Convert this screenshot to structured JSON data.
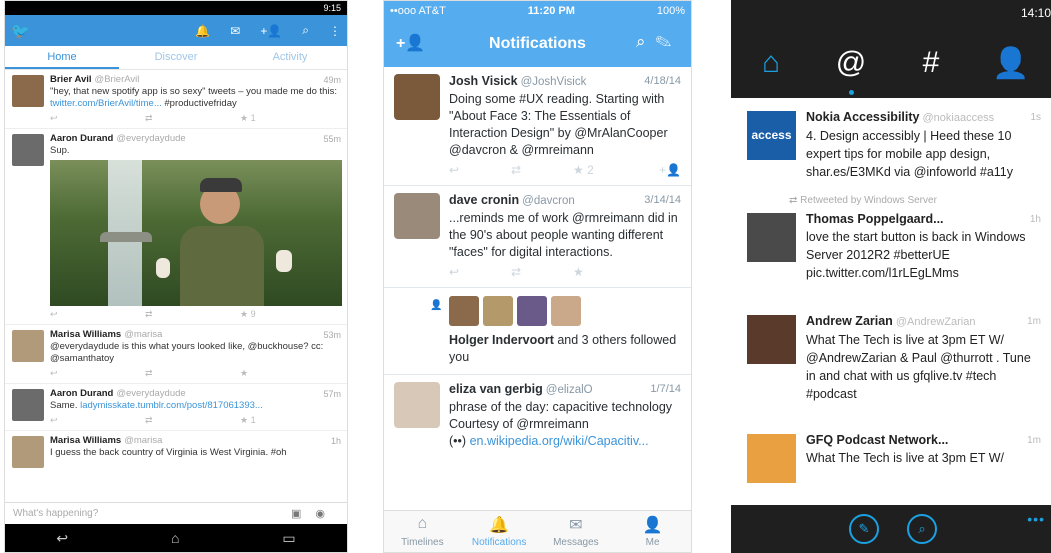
{
  "android": {
    "status_time": "9:15",
    "tabs": [
      "Home",
      "Discover",
      "Activity"
    ],
    "tweets": [
      {
        "name": "Brier Avil",
        "handle": "@BrierAvil",
        "time": "49m",
        "text": "\"hey, that new spotify app is so sexy\" tweets – you made me do this: ",
        "link": "twitter.com/BrierAvil/time...",
        "tail": " #productivefriday",
        "stars": "1"
      },
      {
        "name": "Aaron Durand",
        "handle": "@everydaydude",
        "time": "55m",
        "text": "Sup.",
        "stars": "9"
      },
      {
        "name": "Marisa Williams",
        "handle": "@marisa",
        "time": "53m",
        "text": "@everydaydude is this what yours looked like, @buckhouse? cc: @samanthatoy"
      },
      {
        "name": "Aaron Durand",
        "handle": "@everydaydude",
        "time": "57m",
        "text": "Same. ",
        "link": "ladymisskate.tumblr.com/post/817061393...",
        "stars": "1"
      },
      {
        "name": "Marisa Williams",
        "handle": "@marisa",
        "time": "1h",
        "text": "I guess the back country of Virginia is West Virginia. #oh"
      }
    ],
    "compose_placeholder": "What's happening?"
  },
  "ios": {
    "carrier": "••ooo AT&T",
    "time": "11:20 PM",
    "battery": "100%",
    "title": "Notifications",
    "tweets": [
      {
        "name": "Josh Visick",
        "handle": "@JoshVisick",
        "date": "4/18/14",
        "text": "Doing some #UX reading. Starting with \"About Face 3: The Essentials of Interaction Design\" by @MrAlanCooper @davcron & @rmreimann",
        "stars": "2"
      },
      {
        "name": "dave cronin",
        "handle": "@davcron",
        "date": "3/14/14",
        "text": "...reminds me of work @rmreimann did in the 90's about people wanting different \"faces\" for digital interactions."
      },
      {
        "name": "eliza van gerbig",
        "handle": "@elizalO",
        "date": "1/7/14",
        "text": "phrase of the day: capacitive technology Courtesy of @rmreimann",
        "link": "en.wikipedia.org/wiki/Capacitiv..."
      }
    ],
    "follow": {
      "name": "Holger Indervoort",
      "rest": " and 3 others followed you"
    },
    "tabs": [
      "Timelines",
      "Notifications",
      "Messages",
      "Me"
    ]
  },
  "wp": {
    "time": "14:10",
    "tweets": [
      {
        "name": "Nokia Accessibility",
        "handle": "@nokiaaccess",
        "time": "1s",
        "text": "4. Design accessibly | Heed these 10 expert tips for mobile app design, shar.es/E3MKd via @infoworld #a11y",
        "avatar_text": "access"
      },
      {
        "name": "Thomas Poppelgaard...",
        "time": "1h",
        "text": "love the start button is back in Windows Server 2012R2 #betterUE pic.twitter.com/l1rLEgLMms",
        "retweet": "Retweeted by Windows Server"
      },
      {
        "name": "Andrew Zarian",
        "handle": "@AndrewZarian",
        "time": "1m",
        "text": "What The Tech is live at 3pm ET W/ @AndrewZarian & Paul @thurrott . Tune in and chat with us gfqlive.tv #tech #podcast"
      },
      {
        "name": "GFQ Podcast Network...",
        "time": "1m",
        "text": "What The Tech is live at 3pm ET W/"
      }
    ],
    "more": "•••"
  },
  "colors": {
    "android_blue": "#3b94d9",
    "ios_blue": "#55acee",
    "wp_blue": "#1ba1e2",
    "wp_dark": "#1f1f1f"
  },
  "icons": [
    "bird-icon",
    "bell-icon",
    "mail-icon",
    "add-user-icon",
    "search-icon",
    "compose-icon",
    "home-icon",
    "mention-icon",
    "hashtag-icon",
    "person-icon"
  ]
}
